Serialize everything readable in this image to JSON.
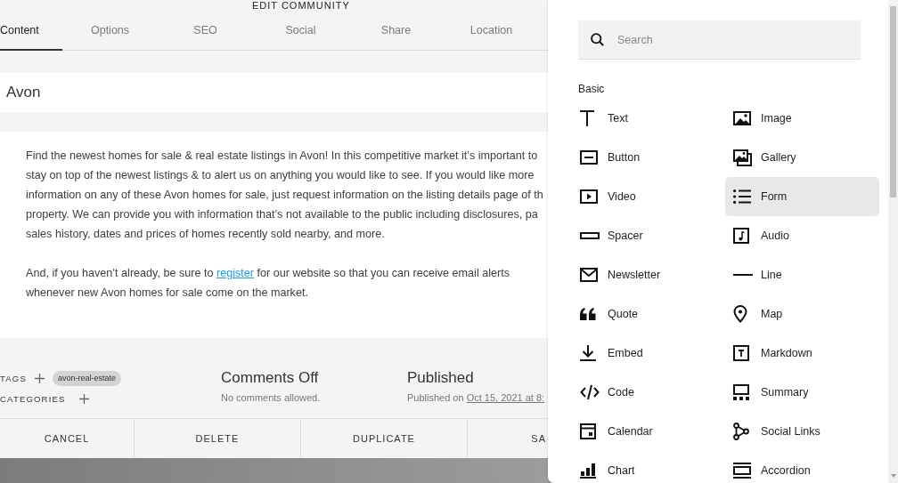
{
  "dialog": {
    "title": "EDIT COMMUNITY",
    "tabs": [
      {
        "label": "Content",
        "selected": true
      },
      {
        "label": "Options",
        "selected": false
      },
      {
        "label": "SEO",
        "selected": false
      },
      {
        "label": "Social",
        "selected": false
      },
      {
        "label": "Share",
        "selected": false
      },
      {
        "label": "Location",
        "selected": false
      }
    ],
    "title_field": {
      "value": "Avon"
    },
    "body": {
      "paragraph_1": "Find the newest homes for sale & real estate listings in Avon! In this competitive market it’s important to\nstay on top of the newest listings & to alert us on anything you would like to see. If you would like more\ninformation on any of these Avon homes for sale, just request information on the listing details page of th\nproperty. We can provide you with information that’s not available to the public including disclosures, pa\nsales history, dates and prices of homes recently sold nearby, and more.",
      "paragraph_2": {
        "before": "And, if you haven’t already, be sure to",
        "link": "register",
        "after": "for our website so that you can receive email alerts\nwhenever new Avon homes for sale come on the market."
      }
    },
    "tags": {
      "label": "TAGS",
      "items": [
        "avon-real-estate"
      ]
    },
    "categories": {
      "label": "CATEGORIES"
    },
    "comments": {
      "status": "Comments Off",
      "note": "No comments allowed."
    },
    "publishing": {
      "status": "Published",
      "prefix": "Published on",
      "date": "Oct 15, 2021 at 8:"
    },
    "buttons": [
      "CANCEL",
      "DELETE",
      "DUPLICATE",
      "SA"
    ]
  },
  "block_menu": {
    "search": {
      "placeholder": "Search"
    },
    "section": "Basic",
    "items": [
      {
        "label": "Text",
        "kind": "text",
        "selected": false
      },
      {
        "label": "Image",
        "kind": "image",
        "selected": false
      },
      {
        "label": "Button",
        "kind": "button",
        "selected": false
      },
      {
        "label": "Gallery",
        "kind": "gallery",
        "selected": false
      },
      {
        "label": "Video",
        "kind": "video",
        "selected": false
      },
      {
        "label": "Form",
        "kind": "form",
        "selected": true
      },
      {
        "label": "Spacer",
        "kind": "spacer",
        "selected": false
      },
      {
        "label": "Audio",
        "kind": "audio",
        "selected": false
      },
      {
        "label": "Newsletter",
        "kind": "newsletter",
        "selected": false
      },
      {
        "label": "Line",
        "kind": "line",
        "selected": false
      },
      {
        "label": "Quote",
        "kind": "quote",
        "selected": false
      },
      {
        "label": "Map",
        "kind": "map",
        "selected": false
      },
      {
        "label": "Embed",
        "kind": "embed",
        "selected": false
      },
      {
        "label": "Markdown",
        "kind": "markdown",
        "selected": false
      },
      {
        "label": "Code",
        "kind": "code",
        "selected": false
      },
      {
        "label": "Summary",
        "kind": "summary",
        "selected": false
      },
      {
        "label": "Calendar",
        "kind": "calendar",
        "selected": false
      },
      {
        "label": "Social Links",
        "kind": "social",
        "selected": false
      },
      {
        "label": "Chart",
        "kind": "chart",
        "selected": false
      },
      {
        "label": "Accordion",
        "kind": "accordion",
        "selected": false
      }
    ]
  }
}
